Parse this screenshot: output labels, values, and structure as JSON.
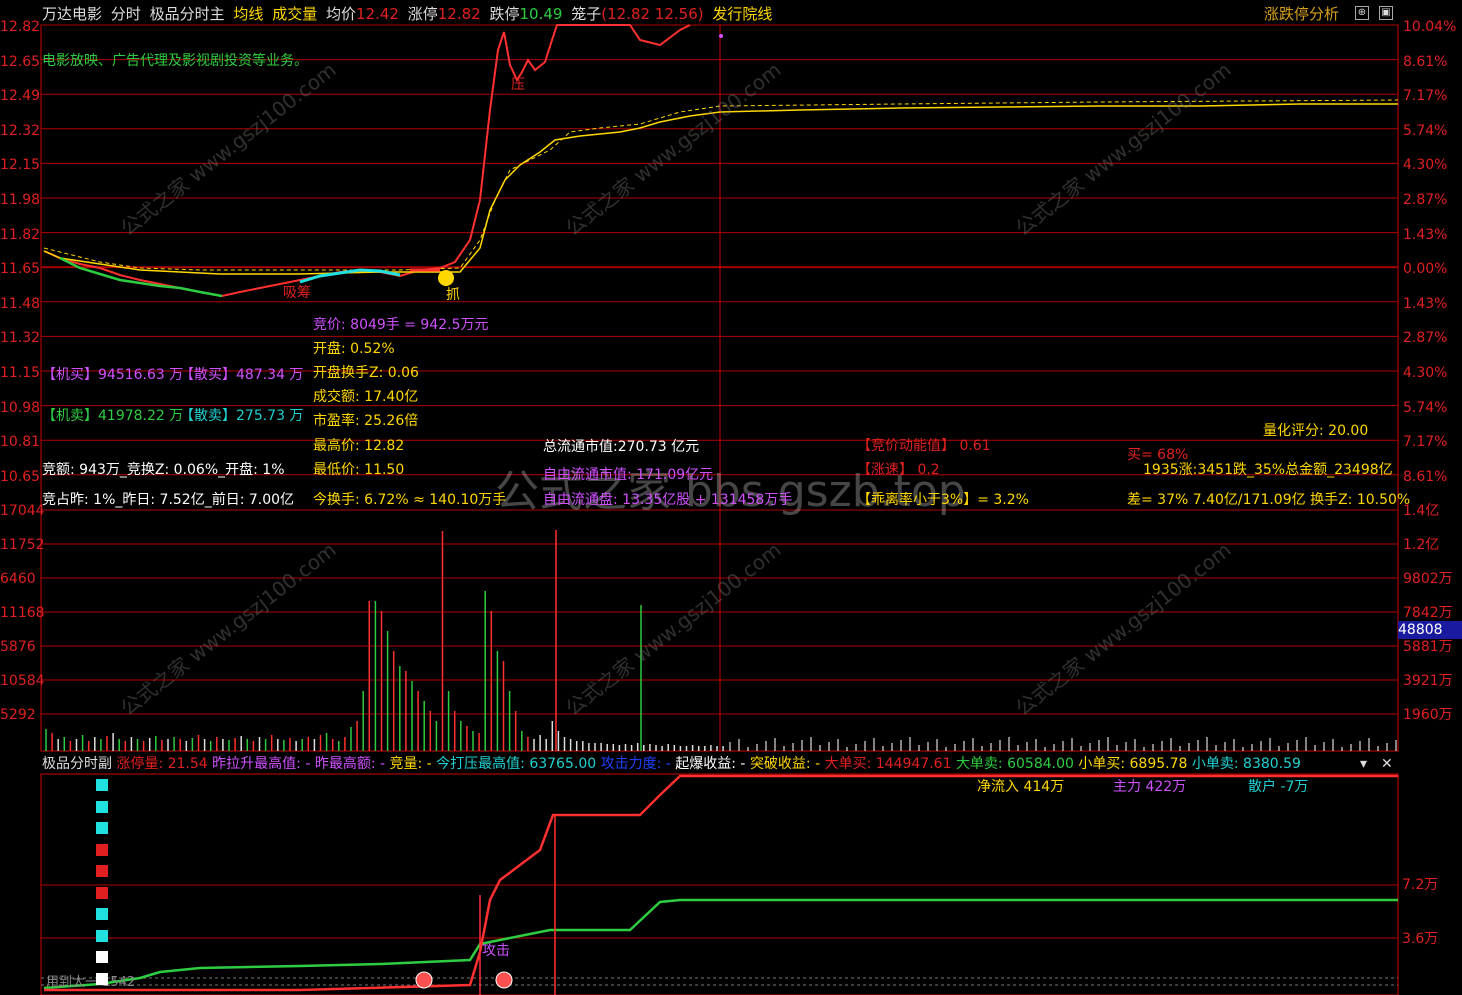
{
  "header": {
    "stock_name": "万达电影",
    "mode": "分时",
    "indicator": "极品分时主",
    "avg_line": "均线",
    "volume": "成交量",
    "avg_price_label": "均价",
    "avg_price": "12.42",
    "limit_up_label": "涨停",
    "limit_up": "12.82",
    "limit_down_label": "跌停",
    "limit_down": "10.49",
    "cage_label": "笼子",
    "cage_value": "(12.82 12.56)",
    "issue_line": "发行院线",
    "analysis_link": "涨跌停分析"
  },
  "business_desc": "电影放映、广告代理及影视剧投资等业务。",
  "price_axis_left": [
    "12.82",
    "12.65",
    "12.49",
    "12.32",
    "12.15",
    "11.98",
    "11.82",
    "11.65",
    "11.48",
    "11.32",
    "11.15",
    "10.98",
    "10.81",
    "10.65"
  ],
  "price_axis_right": [
    "10.04%",
    "8.61%",
    "7.17%",
    "5.74%",
    "4.30%",
    "2.87%",
    "1.43%",
    "0.00%",
    "1.43%",
    "2.87%",
    "4.30%",
    "5.74%",
    "7.17%",
    "8.61%"
  ],
  "markers": {
    "suck": "吸筹",
    "grab": "抓",
    "press": "压",
    "attack": "攻击",
    "suck2": "吸筹",
    "lock": "锁"
  },
  "stats": {
    "bid_price": "竞价: 8049手 = 942.5万元",
    "open": "开盘: 0.52%",
    "open_turnover": "开盘换手Z: 0.06",
    "amount": "成交额: 17.40亿",
    "pe": "市盈率: 25.26倍",
    "high": "最高价: 12.82",
    "low": "最低价: 11.50",
    "turnover": "今换手: 6.72% ≈ 140.10万手",
    "inst_buy": "【机买】94516.63 万",
    "retail_buy": "【散买】487.34 万",
    "inst_sell": "【机卖】41978.22 万",
    "retail_sell": "【散卖】275.73 万",
    "bid_amount": "竞额: 943万_竞换Z: 0.06%_开盘: 1%",
    "bid_ratio": "竞占昨: 1%_昨日: 7.52亿_前日: 7.00亿",
    "total_cap": "总流通市值:270.73 亿元",
    "free_cap": "自由流通市值: 171.09亿元",
    "free_shares": "自由流通盘: 13.35亿股 + 131458万手",
    "bid_energy": "【竞价动能值】 0.61",
    "speed": "【涨速】 0.2",
    "deviation": "【乖离率小于3%】= 3.2%",
    "quant_score": "量化评分:  20.00",
    "buy_pct": "买= 68%",
    "breadth": "1935涨:3451跌_35%总金额_23498亿",
    "diff": "差= 37% 7.40亿/171.09亿  换手Z: 10.50%"
  },
  "watermark": "公式之家 bbs.gszb.top",
  "watermark_small": "公式之家 www.gszj100.com",
  "vol_axis_left": [
    "17044",
    "11752",
    "6460",
    "11168",
    "5876",
    "10584",
    "5292"
  ],
  "vol_axis_right": [
    "1.4亿",
    "1.2亿",
    "9802万",
    "7842万",
    "5881万",
    "3921万",
    "1960万"
  ],
  "vol_current": "48808",
  "sub": {
    "title": "极品分时副",
    "limit_vol": "涨停量: 21.54",
    "prev_max": "昨拉升最高值: -",
    "prev_max_amt": "昨最高额: -",
    "bid_vol": "竞量: -",
    "suppress_max": "今打压最高值: 63765.00",
    "attack_power": "攻击力度: -",
    "burst_gain": "起爆收益: -",
    "break_gain": "突破收益: -",
    "big_buy": "大单买: 144947.61",
    "big_sell": "大单卖: 60584.00",
    "small_buy": "小单买: 6895.78",
    "small_sell": "小单卖: 8380.59",
    "net_inflow": "净流入 414万",
    "main_force": "主力 422万",
    "retail": "散户 -7万",
    "axis_72": "7.2万",
    "axis_36": "3.6万",
    "bottom_text": "用到太一 1542"
  }
}
